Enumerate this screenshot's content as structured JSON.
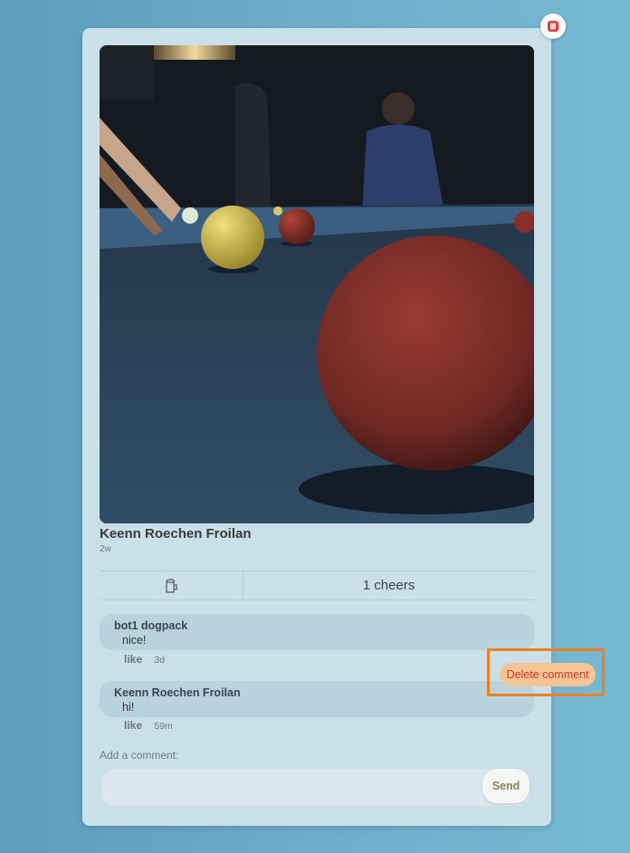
{
  "post": {
    "author": "Keenn Roechen Froilan",
    "time": "2w",
    "cheers_text": "1 cheers"
  },
  "comments": [
    {
      "author": "bot1 dogpack",
      "text": "nice!",
      "like_label": "like",
      "age": "3d"
    },
    {
      "author": "Keenn Roechen Froilan",
      "text": "hi!",
      "like_label": "like",
      "age": "59m"
    }
  ],
  "comment_menu": {
    "dots": "...",
    "delete_label": "Delete comment"
  },
  "composer": {
    "label": "Add a comment:",
    "placeholder": "",
    "send_label": "Send"
  },
  "icons": {
    "delete_post": "trash-icon",
    "cheer": "beer-mug-icon"
  },
  "colors": {
    "delete_red": "#e53935",
    "popup_bg": "#f4c592",
    "highlight": "#f07f22"
  }
}
